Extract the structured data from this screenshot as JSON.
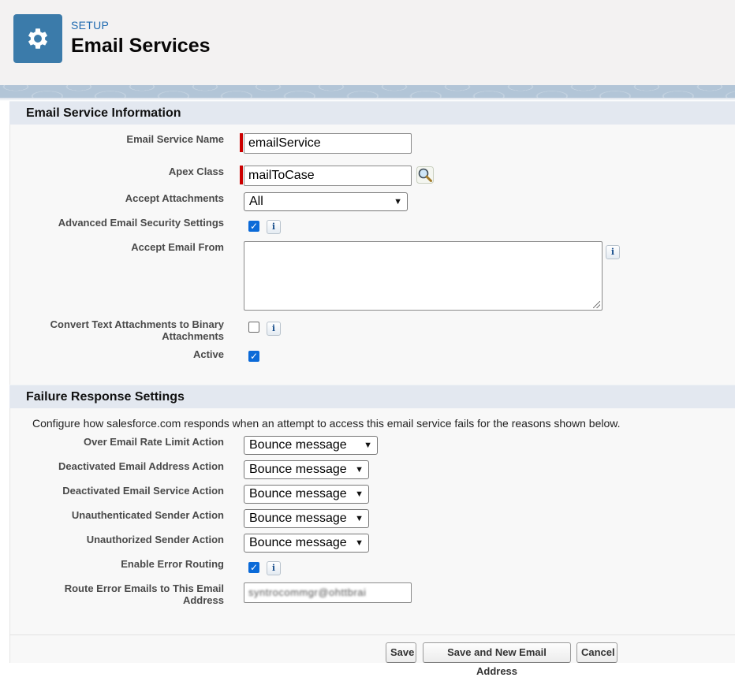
{
  "header": {
    "eyebrow": "SETUP",
    "title": "Email Services",
    "icon": "gear-icon",
    "icon_color": "#3b7baa"
  },
  "section_info": {
    "title": "Email Service Information",
    "fields": {
      "service_name": {
        "label": "Email Service Name",
        "value": "emailService"
      },
      "apex_class": {
        "label": "Apex Class",
        "value": "mailToCase"
      },
      "accept_attachments": {
        "label": "Accept Attachments",
        "value": "All"
      },
      "advanced_security": {
        "label": "Advanced Email Security Settings",
        "checked": true
      },
      "accept_email_from": {
        "label": "Accept Email From",
        "value": ""
      },
      "convert_text_line1": {
        "label": "Convert Text Attachments to Binary"
      },
      "convert_text_line2": {
        "label": "Attachments"
      },
      "convert_text": {
        "checked": false
      },
      "active": {
        "label": "Active",
        "checked": true
      }
    }
  },
  "section_failure": {
    "title": "Failure Response Settings",
    "description": "Configure how salesforce.com responds when an attempt to access this email service fails for the reasons shown below.",
    "fields": {
      "over_rate": {
        "label": "Over Email Rate Limit Action",
        "value": "Bounce message"
      },
      "deactivated_address": {
        "label": "Deactivated Email Address Action",
        "value": "Bounce message"
      },
      "deactivated_service": {
        "label": "Deactivated Email Service Action",
        "value": "Bounce message"
      },
      "unauthenticated": {
        "label": "Unauthenticated Sender Action",
        "value": "Bounce message"
      },
      "unauthorized": {
        "label": "Unauthorized Sender Action",
        "value": "Bounce message"
      },
      "error_routing": {
        "label": "Enable Error Routing",
        "checked": true
      },
      "route_error_line1": {
        "label": "Route Error Emails to This Email"
      },
      "route_error_line2": {
        "label": "Address"
      },
      "route_error_value": "syntrocommgr@ohttbrai"
    }
  },
  "buttons": {
    "save": "Save",
    "save_new": "Save and New Email Address",
    "cancel": "Cancel"
  },
  "colors": {
    "checkbox_checked": "#0b6ad8",
    "required_marker": "#cc0000",
    "section_bar": "#e3e8f0"
  },
  "check_glyph": "✓",
  "info_glyph": "i"
}
